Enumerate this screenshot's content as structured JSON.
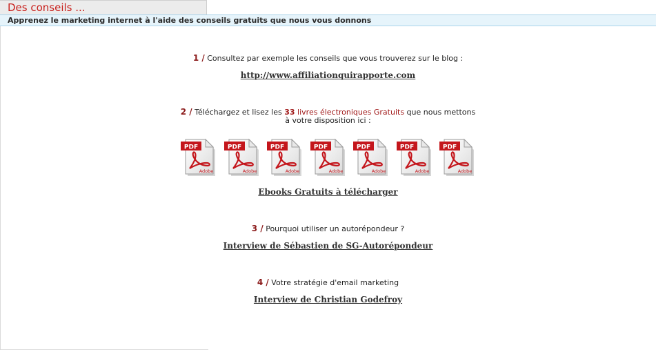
{
  "header": {
    "tab_title": "Des conseils ...",
    "subtitle": "Apprenez le marketing internet à l'aide des conseils gratuits que nous vous donnons"
  },
  "tips": {
    "tip1": {
      "number": "1 /",
      "text": " Consultez par exemple les conseils que vous trouverez sur le blog :",
      "link": "http://www.affiliationquirapporte.com"
    },
    "tip2": {
      "number": "2 /",
      "text_a": " Téléchargez et lisez les ",
      "count": "33",
      "text_b": " livres électroniques Gratuits",
      "text_c": " que nous mettons",
      "text_d": "à votre disposition ici :",
      "pdf_icon_label": "PDF",
      "pdf_icon_brand": "Adobe",
      "link": "Ebooks Gratuits à télécharger"
    },
    "tip3": {
      "number": "3 /",
      "text": " Pourquoi utiliser un autorépondeur ?",
      "link": "Interview de Sébastien de SG-Autorépondeur"
    },
    "tip4": {
      "number": "4 /",
      "text": " Votre stratégie d'email marketing",
      "link": "Interview de Christian Godefroy"
    }
  },
  "icons": {
    "pdf": "pdf-file-icon"
  },
  "colors": {
    "title_red": "#c8201c",
    "number_red": "#8b1a1a",
    "subheader_bg": "#e6f4fb"
  }
}
